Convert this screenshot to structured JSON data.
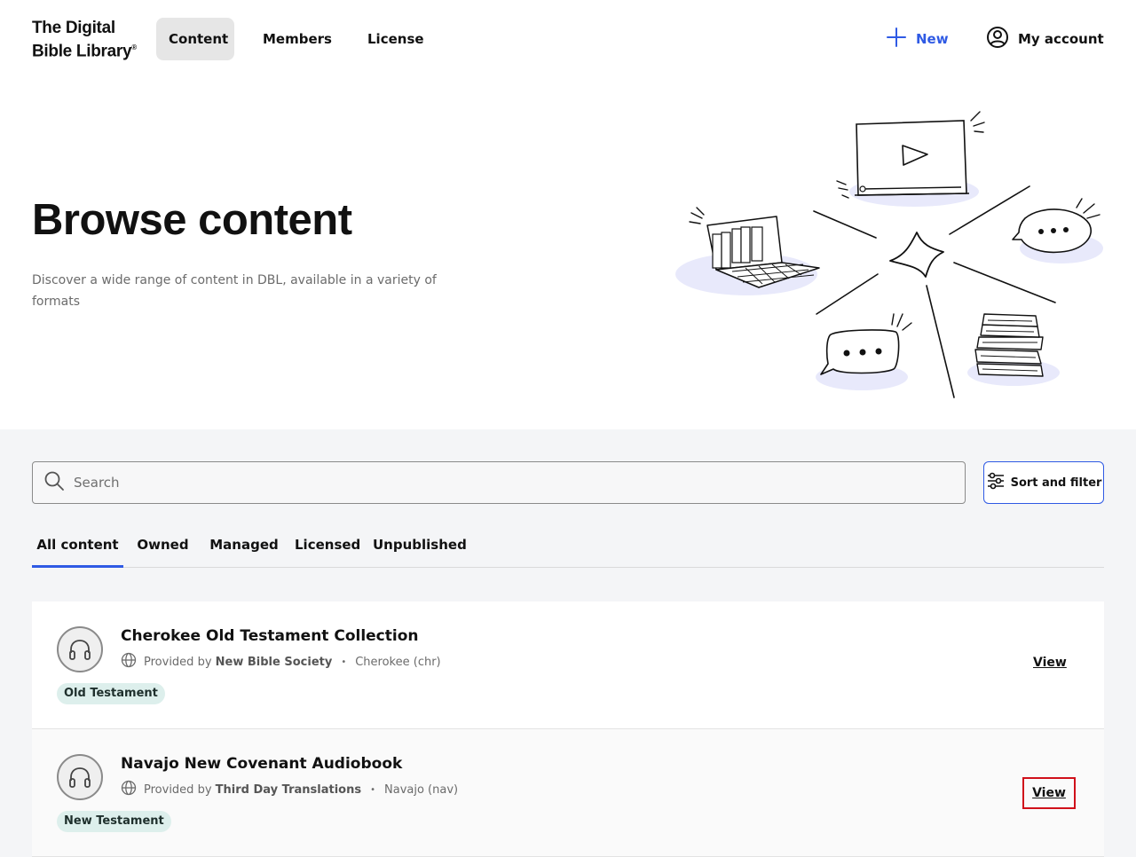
{
  "header": {
    "logo_line1": "The Digital",
    "logo_line2": "Bible Library",
    "logo_mark": "®",
    "nav": [
      {
        "label": "Content",
        "active": true
      },
      {
        "label": "Members",
        "active": false
      },
      {
        "label": "License",
        "active": false
      }
    ],
    "new_label": "New",
    "account_label": "My account"
  },
  "hero": {
    "title": "Browse content",
    "subtitle": "Discover a wide range of content in DBL, available in a variety of formats",
    "illustration": "content-types-illustration"
  },
  "search": {
    "placeholder": "Search",
    "value": "",
    "sort_filter_label": "Sort and filter"
  },
  "tabs": [
    {
      "label": "All content",
      "active": true
    },
    {
      "label": "Owned",
      "active": false
    },
    {
      "label": "Managed",
      "active": false
    },
    {
      "label": "Licensed",
      "active": false
    },
    {
      "label": "Unpublished",
      "active": false
    }
  ],
  "items": [
    {
      "title": "Cherokee Old Testament Collection",
      "provided_by_prefix": "Provided by",
      "provider": "New Bible Society",
      "language": "Cherokee (chr)",
      "badge": "Old Testament",
      "action": "View",
      "icon": "headphones-icon"
    },
    {
      "title": "Navajo New Covenant Audiobook",
      "provided_by_prefix": "Provided by",
      "provider": "Third Day Translations",
      "language": "Navajo (nav)",
      "badge": "New Testament",
      "action": "View",
      "icon": "headphones-icon"
    }
  ],
  "colors": {
    "accent": "#2f5ae4",
    "badge_bg": "#ddefec",
    "section_bg": "#f4f5f7",
    "highlight": "#d0101a",
    "illustration_blob": "#e8e9fb"
  }
}
